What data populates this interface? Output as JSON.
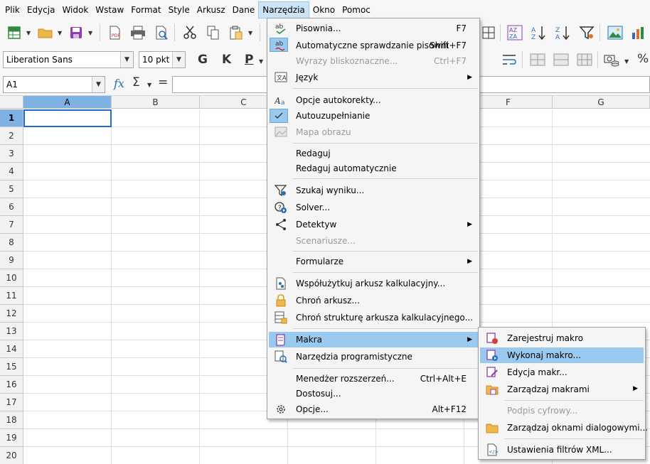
{
  "menubar": {
    "items": [
      {
        "label": "Plik"
      },
      {
        "label": "Edycja"
      },
      {
        "label": "Widok"
      },
      {
        "label": "Wstaw"
      },
      {
        "label": "Format"
      },
      {
        "label": "Style"
      },
      {
        "label": "Arkusz"
      },
      {
        "label": "Dane"
      },
      {
        "label": "Narzędzia",
        "active": true
      },
      {
        "label": "Okno"
      },
      {
        "label": "Pomoc"
      }
    ]
  },
  "formatting": {
    "font_name": "Liberation Sans",
    "font_size": "10 pkt",
    "bold_label": "G",
    "italic_label": "K",
    "underline_label": "P"
  },
  "formula_bar": {
    "cell_ref": "A1",
    "function_wizard": "fx",
    "sum_symbol": "Σ",
    "equals_symbol": "=",
    "formula_value": ""
  },
  "sheet": {
    "columns": [
      "A",
      "B",
      "C",
      "D",
      "E",
      "F",
      "G"
    ],
    "rows": [
      "1",
      "2",
      "3",
      "4",
      "5",
      "6",
      "7",
      "8",
      "9",
      "10",
      "11",
      "12",
      "13",
      "14",
      "15",
      "16",
      "17",
      "18",
      "19",
      "20"
    ],
    "selected_cell": "A1"
  },
  "tools_menu": {
    "items": {
      "spelling": {
        "label": "Pisownia...",
        "shortcut": "F7"
      },
      "auto_spell": {
        "label": "Automatyczne sprawdzanie pisowni",
        "shortcut": "Shift+F7"
      },
      "thesaurus": {
        "label": "Wyrazy bliskoznaczne...",
        "shortcut": "Ctrl+F7"
      },
      "language": {
        "label": "Język"
      },
      "autocorrect": {
        "label": "Opcje autokorekty..."
      },
      "autoinput": {
        "label": "Autouzupełnianie"
      },
      "image_map": {
        "label": "Mapa obrazu"
      },
      "redact": {
        "label": "Redaguj"
      },
      "auto_redact": {
        "label": "Redaguj automatycznie"
      },
      "goal_seek": {
        "label": "Szukaj wyniku..."
      },
      "solver": {
        "label": "Solver..."
      },
      "detective": {
        "label": "Detektyw"
      },
      "scenarios": {
        "label": "Scenariusze..."
      },
      "forms": {
        "label": "Formularze"
      },
      "share": {
        "label": "Współużytkuj arkusz kalkulacyjny..."
      },
      "protect_sheet": {
        "label": "Chroń arkusz..."
      },
      "protect_structure": {
        "label": "Chroń strukturę arkusza kalkulacyjnego..."
      },
      "macros": {
        "label": "Makra"
      },
      "dev_tools": {
        "label": "Narzędzia programistyczne"
      },
      "extensions": {
        "label": "Menedżer rozszerzeń...",
        "shortcut": "Ctrl+Alt+E"
      },
      "customize": {
        "label": "Dostosuj..."
      },
      "options": {
        "label": "Opcje...",
        "shortcut": "Alt+F12"
      }
    }
  },
  "macros_submenu": {
    "items": {
      "record": {
        "label": "Zarejestruj makro"
      },
      "run": {
        "label": "Wykonaj makro..."
      },
      "edit": {
        "label": "Edycja makr..."
      },
      "organize": {
        "label": "Zarządzaj makrami"
      },
      "digital_signature": {
        "label": "Podpis cyfrowy..."
      },
      "dialogs": {
        "label": "Zarządzaj oknami dialogowymi..."
      },
      "xml_filters": {
        "label": "Ustawienia filtrów XML..."
      }
    }
  },
  "colors": {
    "menu_highlight": "#99c9ef",
    "selection_header": "#7fb1e2",
    "cell_cursor": "#1f6cc6"
  }
}
